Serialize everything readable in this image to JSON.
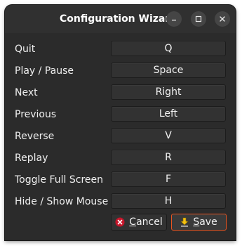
{
  "window": {
    "title": "Configuration Wizard"
  },
  "controls": [
    {
      "action": "Quit",
      "key": "Q"
    },
    {
      "action": "Play / Pause",
      "key": "Space"
    },
    {
      "action": "Next",
      "key": "Right"
    },
    {
      "action": "Previous",
      "key": "Left"
    },
    {
      "action": "Reverse",
      "key": "V"
    },
    {
      "action": "Replay",
      "key": "R"
    },
    {
      "action": "Toggle Full Screen",
      "key": "F"
    },
    {
      "action": "Hide / Show Mouse",
      "key": "H"
    }
  ],
  "footer": {
    "cancel_label_mnemonic": "C",
    "cancel_label_rest": "ancel",
    "save_label_mnemonic": "S",
    "save_label_rest": "ave"
  },
  "icons": {
    "minimize": "minimize-icon",
    "maximize": "maximize-icon",
    "close": "close-icon",
    "cancel": "cancel-x-circle-icon",
    "save": "save-down-arrow-icon"
  },
  "colors": {
    "accent_border": "#e95420",
    "cancel_icon": "#c7162b",
    "save_icon": "#f5c211"
  }
}
